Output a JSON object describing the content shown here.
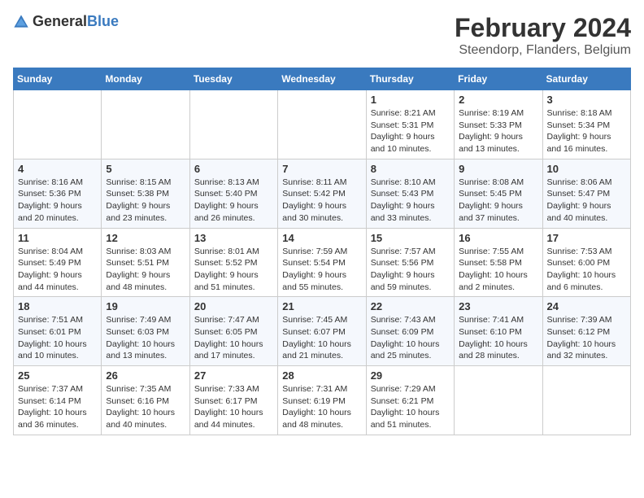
{
  "logo": {
    "text_general": "General",
    "text_blue": "Blue"
  },
  "title": "February 2024",
  "subtitle": "Steendorp, Flanders, Belgium",
  "days_of_week": [
    "Sunday",
    "Monday",
    "Tuesday",
    "Wednesday",
    "Thursday",
    "Friday",
    "Saturday"
  ],
  "weeks": [
    [
      {
        "day": "",
        "info": ""
      },
      {
        "day": "",
        "info": ""
      },
      {
        "day": "",
        "info": ""
      },
      {
        "day": "",
        "info": ""
      },
      {
        "day": "1",
        "info": "Sunrise: 8:21 AM\nSunset: 5:31 PM\nDaylight: 9 hours\nand 10 minutes."
      },
      {
        "day": "2",
        "info": "Sunrise: 8:19 AM\nSunset: 5:33 PM\nDaylight: 9 hours\nand 13 minutes."
      },
      {
        "day": "3",
        "info": "Sunrise: 8:18 AM\nSunset: 5:34 PM\nDaylight: 9 hours\nand 16 minutes."
      }
    ],
    [
      {
        "day": "4",
        "info": "Sunrise: 8:16 AM\nSunset: 5:36 PM\nDaylight: 9 hours\nand 20 minutes."
      },
      {
        "day": "5",
        "info": "Sunrise: 8:15 AM\nSunset: 5:38 PM\nDaylight: 9 hours\nand 23 minutes."
      },
      {
        "day": "6",
        "info": "Sunrise: 8:13 AM\nSunset: 5:40 PM\nDaylight: 9 hours\nand 26 minutes."
      },
      {
        "day": "7",
        "info": "Sunrise: 8:11 AM\nSunset: 5:42 PM\nDaylight: 9 hours\nand 30 minutes."
      },
      {
        "day": "8",
        "info": "Sunrise: 8:10 AM\nSunset: 5:43 PM\nDaylight: 9 hours\nand 33 minutes."
      },
      {
        "day": "9",
        "info": "Sunrise: 8:08 AM\nSunset: 5:45 PM\nDaylight: 9 hours\nand 37 minutes."
      },
      {
        "day": "10",
        "info": "Sunrise: 8:06 AM\nSunset: 5:47 PM\nDaylight: 9 hours\nand 40 minutes."
      }
    ],
    [
      {
        "day": "11",
        "info": "Sunrise: 8:04 AM\nSunset: 5:49 PM\nDaylight: 9 hours\nand 44 minutes."
      },
      {
        "day": "12",
        "info": "Sunrise: 8:03 AM\nSunset: 5:51 PM\nDaylight: 9 hours\nand 48 minutes."
      },
      {
        "day": "13",
        "info": "Sunrise: 8:01 AM\nSunset: 5:52 PM\nDaylight: 9 hours\nand 51 minutes."
      },
      {
        "day": "14",
        "info": "Sunrise: 7:59 AM\nSunset: 5:54 PM\nDaylight: 9 hours\nand 55 minutes."
      },
      {
        "day": "15",
        "info": "Sunrise: 7:57 AM\nSunset: 5:56 PM\nDaylight: 9 hours\nand 59 minutes."
      },
      {
        "day": "16",
        "info": "Sunrise: 7:55 AM\nSunset: 5:58 PM\nDaylight: 10 hours\nand 2 minutes."
      },
      {
        "day": "17",
        "info": "Sunrise: 7:53 AM\nSunset: 6:00 PM\nDaylight: 10 hours\nand 6 minutes."
      }
    ],
    [
      {
        "day": "18",
        "info": "Sunrise: 7:51 AM\nSunset: 6:01 PM\nDaylight: 10 hours\nand 10 minutes."
      },
      {
        "day": "19",
        "info": "Sunrise: 7:49 AM\nSunset: 6:03 PM\nDaylight: 10 hours\nand 13 minutes."
      },
      {
        "day": "20",
        "info": "Sunrise: 7:47 AM\nSunset: 6:05 PM\nDaylight: 10 hours\nand 17 minutes."
      },
      {
        "day": "21",
        "info": "Sunrise: 7:45 AM\nSunset: 6:07 PM\nDaylight: 10 hours\nand 21 minutes."
      },
      {
        "day": "22",
        "info": "Sunrise: 7:43 AM\nSunset: 6:09 PM\nDaylight: 10 hours\nand 25 minutes."
      },
      {
        "day": "23",
        "info": "Sunrise: 7:41 AM\nSunset: 6:10 PM\nDaylight: 10 hours\nand 28 minutes."
      },
      {
        "day": "24",
        "info": "Sunrise: 7:39 AM\nSunset: 6:12 PM\nDaylight: 10 hours\nand 32 minutes."
      }
    ],
    [
      {
        "day": "25",
        "info": "Sunrise: 7:37 AM\nSunset: 6:14 PM\nDaylight: 10 hours\nand 36 minutes."
      },
      {
        "day": "26",
        "info": "Sunrise: 7:35 AM\nSunset: 6:16 PM\nDaylight: 10 hours\nand 40 minutes."
      },
      {
        "day": "27",
        "info": "Sunrise: 7:33 AM\nSunset: 6:17 PM\nDaylight: 10 hours\nand 44 minutes."
      },
      {
        "day": "28",
        "info": "Sunrise: 7:31 AM\nSunset: 6:19 PM\nDaylight: 10 hours\nand 48 minutes."
      },
      {
        "day": "29",
        "info": "Sunrise: 7:29 AM\nSunset: 6:21 PM\nDaylight: 10 hours\nand 51 minutes."
      },
      {
        "day": "",
        "info": ""
      },
      {
        "day": "",
        "info": ""
      }
    ]
  ]
}
